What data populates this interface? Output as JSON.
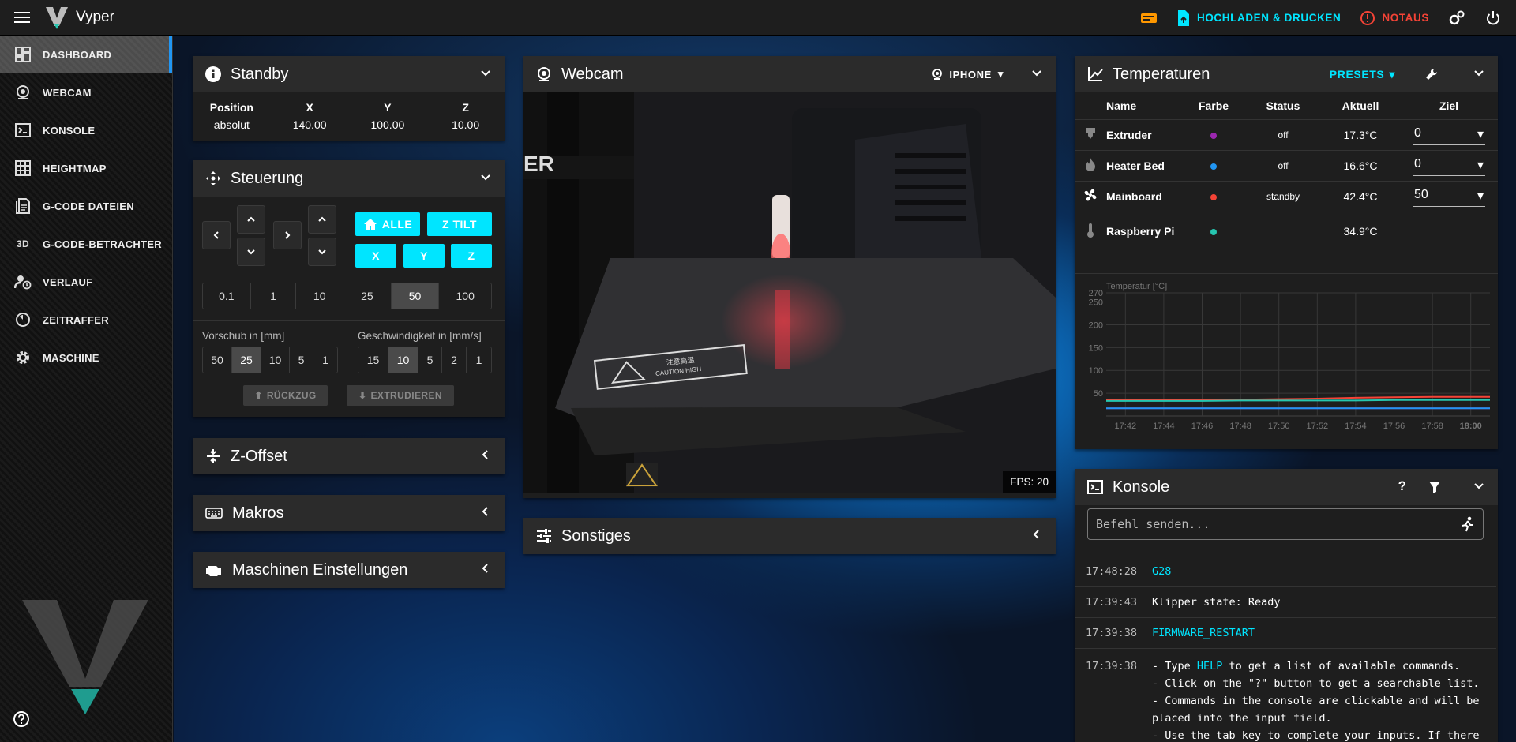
{
  "app": {
    "title": "Vyper"
  },
  "topbar": {
    "upload_label": "HOCHLADEN & DRUCKEN",
    "estop_label": "NOTAUS",
    "accent": "#00e5ff",
    "danger": "#f44336"
  },
  "sidebar": {
    "items": [
      {
        "label": "DASHBOARD",
        "icon": "dashboard-icon"
      },
      {
        "label": "WEBCAM",
        "icon": "webcam-icon"
      },
      {
        "label": "KONSOLE",
        "icon": "console-icon"
      },
      {
        "label": "HEIGHTMAP",
        "icon": "grid-icon"
      },
      {
        "label": "G-CODE DATEIEN",
        "icon": "files-icon"
      },
      {
        "label": "G-CODE-BETRACHTER",
        "icon": "3d-icon"
      },
      {
        "label": "VERLAUF",
        "icon": "history-icon"
      },
      {
        "label": "ZEITRAFFER",
        "icon": "timelapse-icon"
      },
      {
        "label": "MASCHINE",
        "icon": "gear-icon"
      }
    ]
  },
  "standby": {
    "title": "Standby",
    "headers": [
      "Position",
      "X",
      "Y",
      "Z"
    ],
    "values": [
      "absolut",
      "140.00",
      "100.00",
      "10.00"
    ]
  },
  "steuerung": {
    "title": "Steuerung",
    "home_all": "ALLE",
    "z_tilt": "Z TILT",
    "home_x": "X",
    "home_y": "Y",
    "home_z": "Z",
    "steps": [
      "0.1",
      "1",
      "10",
      "25",
      "50",
      "100"
    ],
    "steps_selected": "50",
    "feed_label": "Vorschub in [mm]",
    "feed": [
      "50",
      "25",
      "10",
      "5",
      "1"
    ],
    "feed_selected": "25",
    "speed_label": "Geschwindigkeit in [mm/s]",
    "speed": [
      "15",
      "10",
      "5",
      "2",
      "1"
    ],
    "speed_selected": "10",
    "retract": "RÜCKZUG",
    "extrude": "EXTRUDIEREN"
  },
  "zoffset": {
    "title": "Z-Offset"
  },
  "makros": {
    "title": "Makros"
  },
  "maschine": {
    "title": "Maschinen Einstellungen"
  },
  "webcam": {
    "title": "Webcam",
    "camera": "IPHONE",
    "fps": "FPS: 20"
  },
  "sonstiges": {
    "title": "Sonstiges"
  },
  "temperatures": {
    "title": "Temperaturen",
    "presets": "PRESETS",
    "headers": [
      "Name",
      "Farbe",
      "Status",
      "Aktuell",
      "Ziel"
    ],
    "rows": [
      {
        "name": "Extruder",
        "color": "#9c27b0",
        "status": "off",
        "current": "17.3°C",
        "target": "0"
      },
      {
        "name": "Heater Bed",
        "color": "#2196f3",
        "status": "off",
        "current": "16.6°C",
        "target": "0"
      },
      {
        "name": "Mainboard",
        "color": "#f44336",
        "status": "standby",
        "current": "42.4°C",
        "target": "50"
      },
      {
        "name": "Raspberry Pi",
        "color": "#26c6b0",
        "status": "",
        "current": "34.9°C",
        "target": ""
      }
    ]
  },
  "chart_data": {
    "type": "line",
    "title": "",
    "ylabel": "Temperatur [°C]",
    "ylim": [
      0,
      270
    ],
    "yticks": [
      "50",
      "100",
      "150",
      "200",
      "250",
      "270"
    ],
    "x": [
      "17:42",
      "17:44",
      "17:46",
      "17:48",
      "17:50",
      "17:52",
      "17:54",
      "17:56",
      "17:58",
      "18:00"
    ],
    "series": [
      {
        "color": "#f44336",
        "values": [
          35,
          35,
          36,
          36,
          37,
          38,
          40,
          41,
          42,
          42
        ]
      },
      {
        "color": "#26c6b0",
        "values": [
          33,
          33,
          33,
          34,
          34,
          34,
          34,
          35,
          35,
          35
        ]
      },
      {
        "color": "#9c27b0",
        "values": [
          17,
          17,
          17,
          17,
          17,
          17,
          17,
          17,
          17,
          17
        ]
      },
      {
        "color": "#2196f3",
        "values": [
          17,
          17,
          17,
          17,
          17,
          17,
          17,
          17,
          17,
          17
        ]
      }
    ]
  },
  "console": {
    "title": "Konsole",
    "placeholder": "Befehl senden...",
    "entries": [
      {
        "time": "17:48:28",
        "text": "G28"
      },
      {
        "time": "17:39:43",
        "text": "Klipper state: Ready"
      },
      {
        "time": "17:39:38",
        "text": "FIRMWARE_RESTART"
      }
    ],
    "help_time": "17:39:38",
    "help_lines": [
      "- Type ",
      "HELP",
      " to get a list of available commands.",
      "- Click on the \"?\" button to get a searchable list.",
      "- Commands in the console are clickable and will be",
      "placed into the input field.",
      "- Use the tab key to complete your inputs. If there"
    ]
  }
}
